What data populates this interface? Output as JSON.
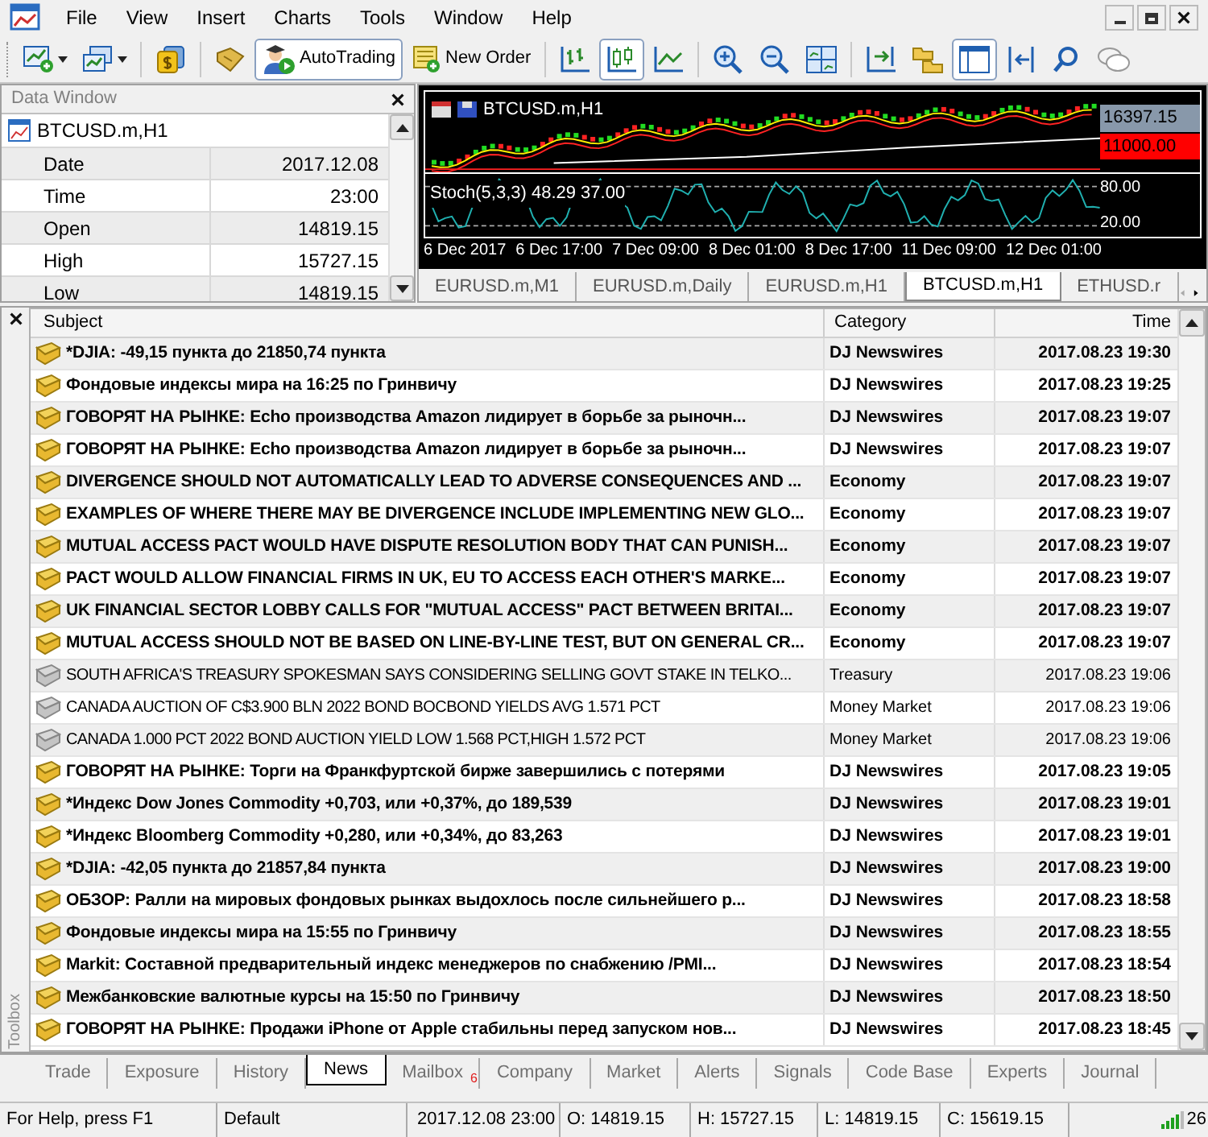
{
  "window": {
    "menu": [
      "File",
      "View",
      "Insert",
      "Charts",
      "Tools",
      "Window",
      "Help"
    ]
  },
  "toolbar": [
    {
      "kind": "icon",
      "selected": false
    },
    {
      "kind": "icon",
      "selected": false
    },
    {
      "kind": "sep"
    },
    {
      "kind": "icon",
      "selected": false
    },
    {
      "kind": "sep"
    },
    {
      "kind": "icon",
      "selected": false
    },
    {
      "kind": "text",
      "label": "AutoTrading",
      "selected": true
    },
    {
      "kind": "text",
      "label": "New Order",
      "selected": false
    },
    {
      "kind": "sep"
    },
    {
      "kind": "icon",
      "selected": false
    },
    {
      "kind": "icon",
      "selected": true
    },
    {
      "kind": "icon",
      "selected": false
    },
    {
      "kind": "sep"
    },
    {
      "kind": "icon",
      "selected": false
    },
    {
      "kind": "icon",
      "selected": false
    },
    {
      "kind": "icon",
      "selected": false
    },
    {
      "kind": "sep"
    },
    {
      "kind": "icon",
      "selected": false
    },
    {
      "kind": "icon",
      "selected": false
    },
    {
      "kind": "icon",
      "selected": true
    },
    {
      "kind": "icon",
      "selected": false
    },
    {
      "kind": "icon",
      "selected": false
    },
    {
      "kind": "icon",
      "selected": false
    }
  ],
  "data_window": {
    "title": "Data Window",
    "symbol": "BTCUSD.m,H1",
    "rows": [
      {
        "label": "Date",
        "value": "2017.12.08"
      },
      {
        "label": "Time",
        "value": "23:00"
      },
      {
        "label": "Open",
        "value": "14819.15"
      },
      {
        "label": "High",
        "value": "15727.15"
      },
      {
        "label": "Low",
        "value": "14819.15"
      }
    ]
  },
  "chart": {
    "title": "BTCUSD.m,H1",
    "price_label": "16397.15",
    "line_label": "11000.00",
    "indicator": "Stoch(5,3,3) 48.29 37.00",
    "indicator_levels": [
      "80.00",
      "20.00"
    ],
    "time_labels": [
      "6 Dec 2017",
      "6 Dec 17:00",
      "7 Dec 09:00",
      "8 Dec 01:00",
      "8 Dec 17:00",
      "11 Dec 09:00",
      "12 Dec 01:00"
    ],
    "tabs": [
      {
        "label": "EURUSD.m,M1",
        "selected": false
      },
      {
        "label": "EURUSD.m,Daily",
        "selected": false
      },
      {
        "label": "EURUSD.m,H1",
        "selected": false
      },
      {
        "label": "BTCUSD.m,H1",
        "selected": true
      },
      {
        "label": "ETHUSD.r",
        "selected": false
      }
    ]
  },
  "news": {
    "columns": [
      "Subject",
      "Category",
      "Time"
    ],
    "rows": [
      {
        "subject": "*DJIA: -49,15 пункта до 21850,74 пункта",
        "category": "DJ Newswires",
        "time": "2017.08.23 19:30",
        "unread": true
      },
      {
        "subject": "Фондовые индексы мира на 16:25 по Гринвичу",
        "category": "DJ Newswires",
        "time": "2017.08.23 19:25",
        "unread": true
      },
      {
        "subject": "ГОВОРЯТ НА РЫНКЕ: Echo производства Amazon лидирует в борьбе за рыночн...",
        "category": "DJ Newswires",
        "time": "2017.08.23 19:07",
        "unread": true
      },
      {
        "subject": "ГОВОРЯТ НА РЫНКЕ: Echo производства Amazon лидирует в борьбе за рыночн...",
        "category": "DJ Newswires",
        "time": "2017.08.23 19:07",
        "unread": true
      },
      {
        "subject": "DIVERGENCE SHOULD NOT AUTOMATICALLY LEAD TO ADVERSE CONSEQUENCES AND ...",
        "category": "Economy",
        "time": "2017.08.23 19:07",
        "unread": true
      },
      {
        "subject": "EXAMPLES OF WHERE THERE MAY BE DIVERGENCE INCLUDE IMPLEMENTING NEW GLO...",
        "category": "Economy",
        "time": "2017.08.23 19:07",
        "unread": true
      },
      {
        "subject": "MUTUAL ACCESS PACT WOULD HAVE DISPUTE RESOLUTION BODY THAT CAN PUNISH...",
        "category": "Economy",
        "time": "2017.08.23 19:07",
        "unread": true
      },
      {
        "subject": "PACT WOULD ALLOW FINANCIAL FIRMS IN UK, EU TO ACCESS EACH OTHER'S MARKE...",
        "category": "Economy",
        "time": "2017.08.23 19:07",
        "unread": true
      },
      {
        "subject": "UK FINANCIAL SECTOR LOBBY CALLS FOR \"MUTUAL ACCESS\" PACT BETWEEN BRITAI...",
        "category": "Economy",
        "time": "2017.08.23 19:07",
        "unread": true
      },
      {
        "subject": "MUTUAL ACCESS SHOULD NOT BE BASED ON LINE-BY-LINE TEST, BUT ON GENERAL CR...",
        "category": "Economy",
        "time": "2017.08.23 19:07",
        "unread": true
      },
      {
        "subject": "SOUTH AFRICA'S TREASURY SPOKESMAN SAYS CONSIDERING SELLING GOVT STAKE IN TELKO...",
        "category": "Treasury",
        "time": "2017.08.23 19:06",
        "unread": false
      },
      {
        "subject": "CANADA AUCTION OF C$3.900 BLN 2022 BOND  BOCBOND YIELDS AVG 1.571 PCT",
        "category": "Money Market",
        "time": "2017.08.23 19:06",
        "unread": false
      },
      {
        "subject": "CANADA 1.000 PCT 2022 BOND AUCTION YIELD LOW 1.568 PCT,HIGH 1.572 PCT",
        "category": "Money Market",
        "time": "2017.08.23 19:06",
        "unread": false
      },
      {
        "subject": "ГОВОРЯТ НА РЫНКЕ: Торги на Франкфуртской бирже завершились с потерями",
        "category": "DJ Newswires",
        "time": "2017.08.23 19:05",
        "unread": true
      },
      {
        "subject": "*Индекс Dow Jones Commodity +0,703, или +0,37%, до 189,539",
        "category": "DJ Newswires",
        "time": "2017.08.23 19:01",
        "unread": true
      },
      {
        "subject": "*Индекс Bloomberg Commodity +0,280, или +0,34%, до 83,263",
        "category": "DJ Newswires",
        "time": "2017.08.23 19:01",
        "unread": true
      },
      {
        "subject": "*DJIA: -42,05 пункта до 21857,84 пункта",
        "category": "DJ Newswires",
        "time": "2017.08.23 19:00",
        "unread": true
      },
      {
        "subject": "ОБЗОР: Ралли на мировых фондовых рынках выдохлось после сильнейшего р...",
        "category": "DJ Newswires",
        "time": "2017.08.23 18:58",
        "unread": true
      },
      {
        "subject": "Фондовые индексы мира на 15:55 по Гринвичу",
        "category": "DJ Newswires",
        "time": "2017.08.23 18:55",
        "unread": true
      },
      {
        "subject": "Markit: Составной предварительный индекс менеджеров по снабжению /PMI...",
        "category": "DJ Newswires",
        "time": "2017.08.23 18:54",
        "unread": true
      },
      {
        "subject": "Межбанковские валютные курсы на 15:50 по Гринвичу",
        "category": "DJ Newswires",
        "time": "2017.08.23 18:50",
        "unread": true
      },
      {
        "subject": "ГОВОРЯТ НА РЫНКЕ: Продажи iPhone от Apple стабильны перед запуском нов...",
        "category": "DJ Newswires",
        "time": "2017.08.23 18:45",
        "unread": true
      }
    ]
  },
  "toolbox": {
    "label": "Toolbox",
    "tabs": [
      {
        "label": "Trade",
        "selected": false
      },
      {
        "label": "Exposure",
        "selected": false
      },
      {
        "label": "History",
        "selected": false
      },
      {
        "label": "News",
        "selected": true
      },
      {
        "label": "Mailbox",
        "badge": "6",
        "selected": false
      },
      {
        "label": "Company",
        "selected": false
      },
      {
        "label": "Market",
        "selected": false
      },
      {
        "label": "Alerts",
        "selected": false
      },
      {
        "label": "Signals",
        "selected": false
      },
      {
        "label": "Code Base",
        "selected": false
      },
      {
        "label": "Experts",
        "selected": false
      },
      {
        "label": "Journal",
        "selected": false
      }
    ]
  },
  "status_bar": {
    "help": "For Help, press F1",
    "profile": "Default",
    "datetime": "2017.12.08 23:00",
    "open": "O: 14819.15",
    "high": "H: 15727.15",
    "low": "L: 14819.15",
    "close": "C: 15619.15",
    "connection": "26"
  }
}
